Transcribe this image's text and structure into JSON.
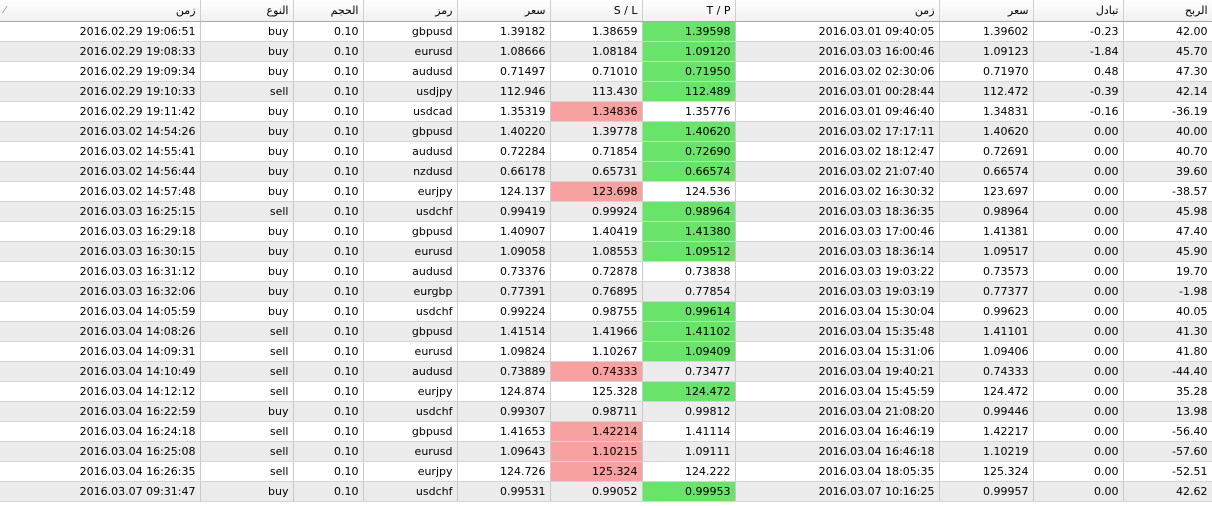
{
  "headers": {
    "open_time": "زمن",
    "type": "النوع",
    "volume": "الحجم",
    "symbol": "رمز",
    "open_price": "سعر",
    "sl": "S / L",
    "tp": "T / P",
    "close_time": "زمن",
    "close_price": "سعر",
    "swap": "تبادل",
    "profit": "الربح"
  },
  "colors": {
    "tp_hit": "#6ae36a",
    "sl_hit": "#f7a1a1",
    "stripe": "#ececec"
  },
  "sort_icon": "sort-indicator-icon",
  "rows": [
    {
      "open_time": "2016.02.29 19:06:51",
      "type": "buy",
      "volume": "0.10",
      "symbol": "gbpusd",
      "open_price": "1.39182",
      "sl": "1.38659",
      "tp": "1.39598",
      "close_time": "2016.03.01 09:40:05",
      "close_price": "1.39602",
      "swap": "-0.23",
      "profit": "42.00",
      "hit": "tp"
    },
    {
      "open_time": "2016.02.29 19:08:33",
      "type": "buy",
      "volume": "0.10",
      "symbol": "eurusd",
      "open_price": "1.08666",
      "sl": "1.08184",
      "tp": "1.09120",
      "close_time": "2016.03.03 16:00:46",
      "close_price": "1.09123",
      "swap": "-1.84",
      "profit": "45.70",
      "hit": "tp"
    },
    {
      "open_time": "2016.02.29 19:09:34",
      "type": "buy",
      "volume": "0.10",
      "symbol": "audusd",
      "open_price": "0.71497",
      "sl": "0.71010",
      "tp": "0.71950",
      "close_time": "2016.03.02 02:30:06",
      "close_price": "0.71970",
      "swap": "0.48",
      "profit": "47.30",
      "hit": "tp"
    },
    {
      "open_time": "2016.02.29 19:10:33",
      "type": "sell",
      "volume": "0.10",
      "symbol": "usdjpy",
      "open_price": "112.946",
      "sl": "113.430",
      "tp": "112.489",
      "close_time": "2016.03.01 00:28:44",
      "close_price": "112.472",
      "swap": "-0.39",
      "profit": "42.14",
      "hit": "tp"
    },
    {
      "open_time": "2016.02.29 19:11:42",
      "type": "buy",
      "volume": "0.10",
      "symbol": "usdcad",
      "open_price": "1.35319",
      "sl": "1.34836",
      "tp": "1.35776",
      "close_time": "2016.03.01 09:46:40",
      "close_price": "1.34831",
      "swap": "-0.16",
      "profit": "-36.19",
      "hit": "sl"
    },
    {
      "open_time": "2016.03.02 14:54:26",
      "type": "buy",
      "volume": "0.10",
      "symbol": "gbpusd",
      "open_price": "1.40220",
      "sl": "1.39778",
      "tp": "1.40620",
      "close_time": "2016.03.02 17:17:11",
      "close_price": "1.40620",
      "swap": "0.00",
      "profit": "40.00",
      "hit": "tp"
    },
    {
      "open_time": "2016.03.02 14:55:41",
      "type": "buy",
      "volume": "0.10",
      "symbol": "audusd",
      "open_price": "0.72284",
      "sl": "0.71854",
      "tp": "0.72690",
      "close_time": "2016.03.02 18:12:47",
      "close_price": "0.72691",
      "swap": "0.00",
      "profit": "40.70",
      "hit": "tp"
    },
    {
      "open_time": "2016.03.02 14:56:44",
      "type": "buy",
      "volume": "0.10",
      "symbol": "nzdusd",
      "open_price": "0.66178",
      "sl": "0.65731",
      "tp": "0.66574",
      "close_time": "2016.03.02 21:07:40",
      "close_price": "0.66574",
      "swap": "0.00",
      "profit": "39.60",
      "hit": "tp"
    },
    {
      "open_time": "2016.03.02 14:57:48",
      "type": "buy",
      "volume": "0.10",
      "symbol": "eurjpy",
      "open_price": "124.137",
      "sl": "123.698",
      "tp": "124.536",
      "close_time": "2016.03.02 16:30:32",
      "close_price": "123.697",
      "swap": "0.00",
      "profit": "-38.57",
      "hit": "sl"
    },
    {
      "open_time": "2016.03.03 16:25:15",
      "type": "sell",
      "volume": "0.10",
      "symbol": "usdchf",
      "open_price": "0.99419",
      "sl": "0.99924",
      "tp": "0.98964",
      "close_time": "2016.03.03 18:36:35",
      "close_price": "0.98964",
      "swap": "0.00",
      "profit": "45.98",
      "hit": "tp"
    },
    {
      "open_time": "2016.03.03 16:29:18",
      "type": "buy",
      "volume": "0.10",
      "symbol": "gbpusd",
      "open_price": "1.40907",
      "sl": "1.40419",
      "tp": "1.41380",
      "close_time": "2016.03.03 17:00:46",
      "close_price": "1.41381",
      "swap": "0.00",
      "profit": "47.40",
      "hit": "tp"
    },
    {
      "open_time": "2016.03.03 16:30:15",
      "type": "buy",
      "volume": "0.10",
      "symbol": "eurusd",
      "open_price": "1.09058",
      "sl": "1.08553",
      "tp": "1.09512",
      "close_time": "2016.03.03 18:36:14",
      "close_price": "1.09517",
      "swap": "0.00",
      "profit": "45.90",
      "hit": "tp"
    },
    {
      "open_time": "2016.03.03 16:31:12",
      "type": "buy",
      "volume": "0.10",
      "symbol": "audusd",
      "open_price": "0.73376",
      "sl": "0.72878",
      "tp": "0.73838",
      "close_time": "2016.03.03 19:03:22",
      "close_price": "0.73573",
      "swap": "0.00",
      "profit": "19.70",
      "hit": ""
    },
    {
      "open_time": "2016.03.03 16:32:06",
      "type": "buy",
      "volume": "0.10",
      "symbol": "eurgbp",
      "open_price": "0.77391",
      "sl": "0.76895",
      "tp": "0.77854",
      "close_time": "2016.03.03 19:03:19",
      "close_price": "0.77377",
      "swap": "0.00",
      "profit": "-1.98",
      "hit": ""
    },
    {
      "open_time": "2016.03.04 14:05:59",
      "type": "buy",
      "volume": "0.10",
      "symbol": "usdchf",
      "open_price": "0.99224",
      "sl": "0.98755",
      "tp": "0.99614",
      "close_time": "2016.03.04 15:30:04",
      "close_price": "0.99623",
      "swap": "0.00",
      "profit": "40.05",
      "hit": "tp"
    },
    {
      "open_time": "2016.03.04 14:08:26",
      "type": "sell",
      "volume": "0.10",
      "symbol": "gbpusd",
      "open_price": "1.41514",
      "sl": "1.41966",
      "tp": "1.41102",
      "close_time": "2016.03.04 15:35:48",
      "close_price": "1.41101",
      "swap": "0.00",
      "profit": "41.30",
      "hit": "tp"
    },
    {
      "open_time": "2016.03.04 14:09:31",
      "type": "sell",
      "volume": "0.10",
      "symbol": "eurusd",
      "open_price": "1.09824",
      "sl": "1.10267",
      "tp": "1.09409",
      "close_time": "2016.03.04 15:31:06",
      "close_price": "1.09406",
      "swap": "0.00",
      "profit": "41.80",
      "hit": "tp"
    },
    {
      "open_time": "2016.03.04 14:10:49",
      "type": "sell",
      "volume": "0.10",
      "symbol": "audusd",
      "open_price": "0.73889",
      "sl": "0.74333",
      "tp": "0.73477",
      "close_time": "2016.03.04 19:40:21",
      "close_price": "0.74333",
      "swap": "0.00",
      "profit": "-44.40",
      "hit": "sl"
    },
    {
      "open_time": "2016.03.04 14:12:12",
      "type": "sell",
      "volume": "0.10",
      "symbol": "eurjpy",
      "open_price": "124.874",
      "sl": "125.328",
      "tp": "124.472",
      "close_time": "2016.03.04 15:45:59",
      "close_price": "124.472",
      "swap": "0.00",
      "profit": "35.28",
      "hit": "tp"
    },
    {
      "open_time": "2016.03.04 16:22:59",
      "type": "buy",
      "volume": "0.10",
      "symbol": "usdchf",
      "open_price": "0.99307",
      "sl": "0.98711",
      "tp": "0.99812",
      "close_time": "2016.03.04 21:08:20",
      "close_price": "0.99446",
      "swap": "0.00",
      "profit": "13.98",
      "hit": ""
    },
    {
      "open_time": "2016.03.04 16:24:18",
      "type": "sell",
      "volume": "0.10",
      "symbol": "gbpusd",
      "open_price": "1.41653",
      "sl": "1.42214",
      "tp": "1.41114",
      "close_time": "2016.03.04 16:46:19",
      "close_price": "1.42217",
      "swap": "0.00",
      "profit": "-56.40",
      "hit": "sl"
    },
    {
      "open_time": "2016.03.04 16:25:08",
      "type": "sell",
      "volume": "0.10",
      "symbol": "eurusd",
      "open_price": "1.09643",
      "sl": "1.10215",
      "tp": "1.09111",
      "close_time": "2016.03.04 16:46:18",
      "close_price": "1.10219",
      "swap": "0.00",
      "profit": "-57.60",
      "hit": "sl"
    },
    {
      "open_time": "2016.03.04 16:26:35",
      "type": "sell",
      "volume": "0.10",
      "symbol": "eurjpy",
      "open_price": "124.726",
      "sl": "125.324",
      "tp": "124.222",
      "close_time": "2016.03.04 18:05:35",
      "close_price": "125.324",
      "swap": "0.00",
      "profit": "-52.51",
      "hit": "sl"
    },
    {
      "open_time": "2016.03.07 09:31:47",
      "type": "buy",
      "volume": "0.10",
      "symbol": "usdchf",
      "open_price": "0.99531",
      "sl": "0.99052",
      "tp": "0.99953",
      "close_time": "2016.03.07 10:16:25",
      "close_price": "0.99957",
      "swap": "0.00",
      "profit": "42.62",
      "hit": "tp"
    }
  ]
}
